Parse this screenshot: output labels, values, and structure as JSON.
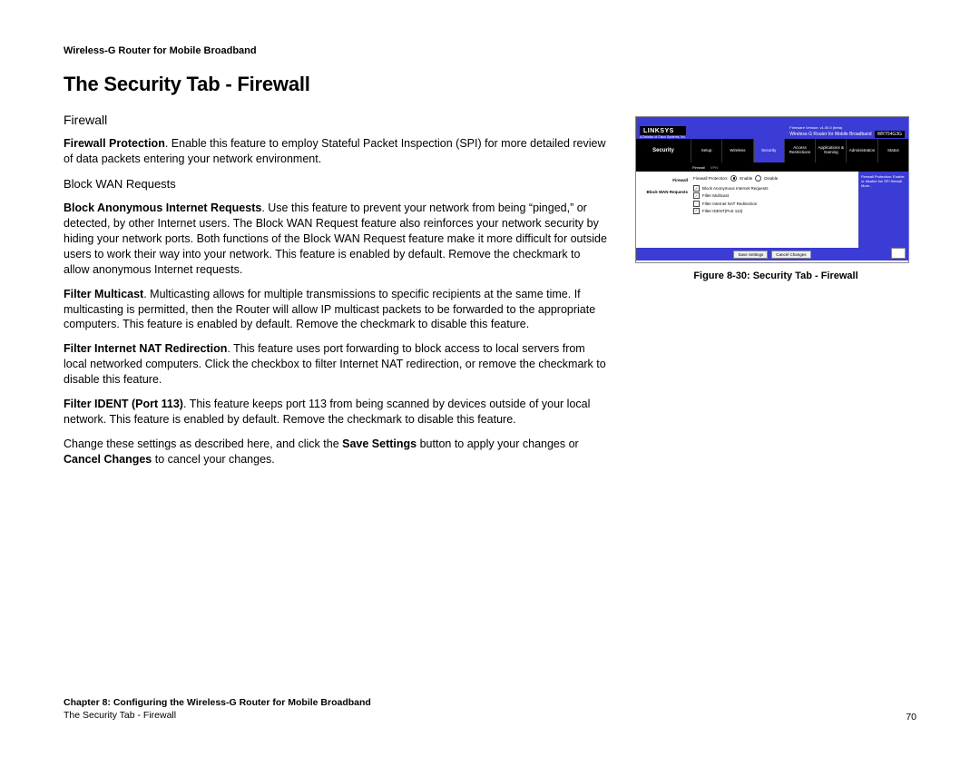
{
  "header": "Wireless-G Router for Mobile Broadband",
  "title": "The Security Tab - Firewall",
  "section": "Firewall",
  "p_firewall_protection": {
    "label": "Firewall Protection",
    "text": ". Enable this feature to employ Stateful Packet Inspection (SPI) for more detailed review of data packets entering your network environment."
  },
  "subsection": "Block WAN Requests",
  "p_block_anon": {
    "label": "Block Anonymous Internet Requests",
    "text": ". Use this feature to prevent your network from being “pinged,” or detected, by other Internet users. The Block WAN Request feature also reinforces your network security by hiding your network ports. Both functions of the Block WAN Request feature make it more difficult for outside users to work their way into your network. This feature is enabled by default. Remove the checkmark to allow anonymous Internet requests."
  },
  "p_filter_multicast": {
    "label": "Filter Multicast",
    "text": ". Multicasting allows for multiple transmissions to specific recipients at the same time. If multicasting is permitted, then the Router will allow IP multicast packets to be forwarded to the appropriate computers. This feature is enabled by default. Remove the checkmark to disable this feature."
  },
  "p_filter_nat": {
    "label": "Filter Internet NAT Redirection",
    "text": ". This feature uses port forwarding to block access to local servers from local networked computers. Click the checkbox to filter Internet NAT redirection, or remove the checkmark to disable this feature."
  },
  "p_filter_ident": {
    "label": "Filter IDENT (Port 113)",
    "text": ". This feature keeps port 113 from being scanned by devices outside of your local network. This feature is enabled by default. Remove the checkmark to disable this feature."
  },
  "p_save": {
    "pre": "Change these settings as described here, and click the ",
    "btn1": "Save Settings",
    "mid": " button to apply your changes or ",
    "btn2": "Cancel Changes",
    "post": " to cancel your changes."
  },
  "figure_caption": "Figure 8-30: Security Tab - Firewall",
  "shot": {
    "brand": "LINKSYS",
    "tagline": "A Division of Cisco Systems, Inc.",
    "firmware": "Firmware Version: v1.00.0 (beta)",
    "product": "Wireless-G Router for Mobile Broadband",
    "model": "WRT54G3G",
    "nav_title": "Security",
    "tabs": [
      "Setup",
      "Wireless",
      "Security",
      "Access Restrictions",
      "Applications & Gaming",
      "Administration",
      "Status"
    ],
    "subtabs": [
      "Firewall",
      "VPN"
    ],
    "side_labels": [
      "Firewall",
      "Block WAN Requests"
    ],
    "form": {
      "protection_label": "Firewall Protection:",
      "enable": "Enable",
      "disable": "Disable",
      "opt1": "Block Anonymous Internet Requests",
      "opt2": "Filter Multicast",
      "opt3": "Filter Internet NAT Redirection",
      "opt4": "Filter IDENT(Port 113)"
    },
    "help": "Firewall Protection: Enable or disable the SPI firewall. More...",
    "save": "Save Settings",
    "cancel": "Cancel Changes"
  },
  "footer": {
    "chapter": "Chapter 8: Configuring the Wireless-G Router for Mobile Broadband",
    "subline": "The Security Tab - Firewall",
    "page": "70"
  }
}
